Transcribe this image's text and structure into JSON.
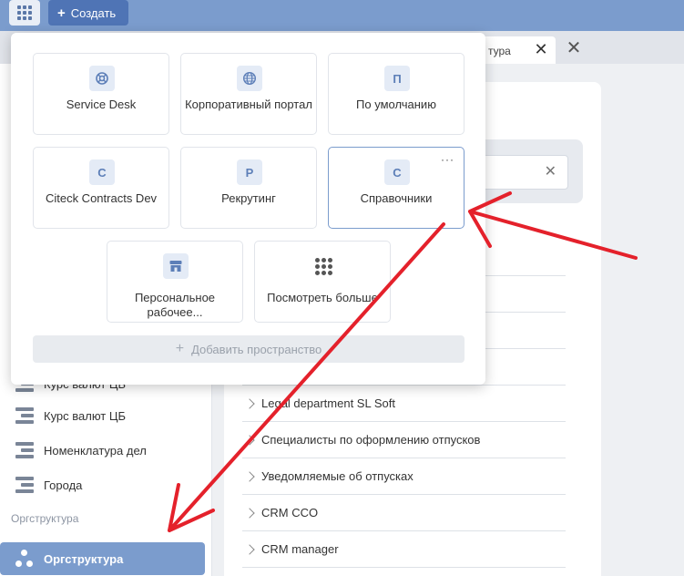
{
  "topbar": {
    "create_label": "Создать",
    "apps_icon": "apps-grid-icon",
    "plus_glyph": "+"
  },
  "tabs": {
    "active_label": "тура",
    "close_glyph": "✕"
  },
  "popup": {
    "cards": [
      {
        "label": "Service Desk",
        "icon": "lifebuoy-icon",
        "glyph": ""
      },
      {
        "label": "Корпоративный портал",
        "icon": "globe-icon",
        "glyph": ""
      },
      {
        "label": "По умолчанию",
        "icon": "letter-p-icon",
        "glyph": "П"
      },
      {
        "label": "Citeck Contracts Dev",
        "icon": "letter-c-icon",
        "glyph": "C"
      },
      {
        "label": "Рекрутинг",
        "icon": "letter-r-icon",
        "glyph": "Р"
      },
      {
        "label": "Справочники",
        "icon": "letter-c-icon",
        "glyph": "С",
        "menu": "···"
      },
      {
        "label": "Персональное рабочее...",
        "icon": "store-icon",
        "glyph": ""
      },
      {
        "label": "Посмотреть больше",
        "icon": "dots-grid-icon",
        "glyph": ""
      }
    ],
    "add_space_label": "Добавить пространство",
    "add_plus": "+"
  },
  "sidebar": {
    "partial_item": "Курс валют ЦБ",
    "items": [
      {
        "label": "Курс валют ЦБ"
      },
      {
        "label": "Номенклатура дел"
      },
      {
        "label": "Города"
      }
    ],
    "section_label": "Оргструктура",
    "active_item": "Оргструктура"
  },
  "main": {
    "rows": [
      {
        "label": "Legal department SL Soft"
      },
      {
        "label": "Специалисты по оформлению отпусков"
      },
      {
        "label": "Уведомляемые об отпусках"
      },
      {
        "label": "CRM CCO"
      },
      {
        "label": "CRM manager"
      }
    ],
    "clear_glyph": "✕"
  },
  "colors": {
    "topbar": "#7b9ccd",
    "create_button": "#4f74b5",
    "active_sidebar": "#7b9ccd",
    "annotation_arrow": "#e4212b"
  }
}
